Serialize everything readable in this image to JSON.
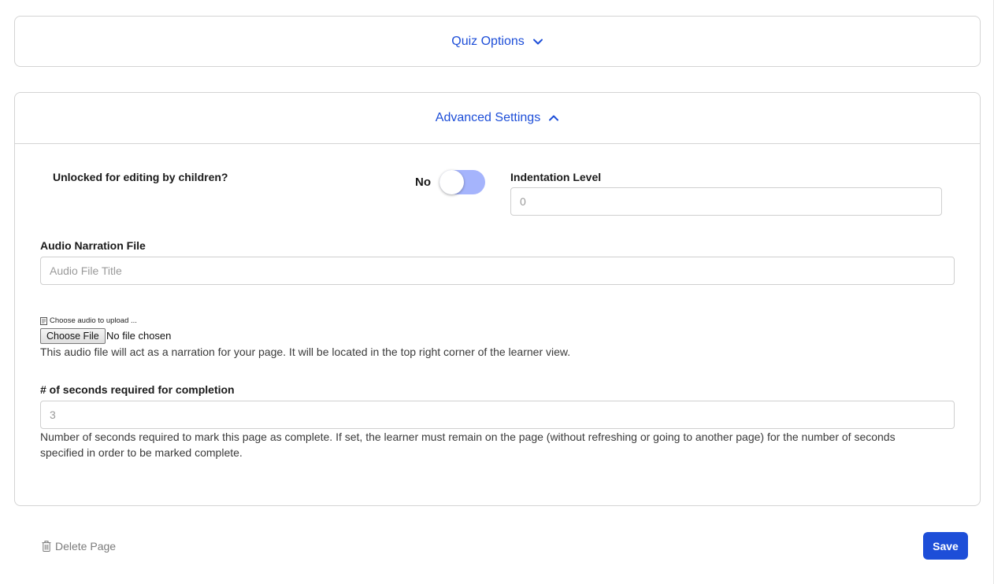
{
  "quiz_options": {
    "label": "Quiz Options"
  },
  "advanced_settings": {
    "label": "Advanced Settings",
    "unlocked": {
      "label": "Unlocked for editing by children?",
      "state_label": "No",
      "value": false
    },
    "indentation": {
      "label": "Indentation Level",
      "placeholder": "0"
    },
    "audio": {
      "label": "Audio Narration File",
      "title_placeholder": "Audio File Title",
      "upload_hint": "Choose audio to upload ...",
      "choose_button": "Choose File",
      "no_file_text": "No file chosen",
      "help": "This audio file will act as a narration for your page. It will be located in the top right corner of the learner view."
    },
    "seconds": {
      "label": "# of seconds required for completion",
      "placeholder": "3",
      "help": "Number of seconds required to mark this page as complete. If set, the learner must remain on the page (without refreshing or going to another page) for the number of seconds specified in order to be marked complete."
    }
  },
  "footer": {
    "delete_label": "Delete Page",
    "save_label": "Save"
  },
  "colors": {
    "accent": "#1d4ed8",
    "toggle_track": "#a5b4fc",
    "border": "#d4d4d4"
  }
}
